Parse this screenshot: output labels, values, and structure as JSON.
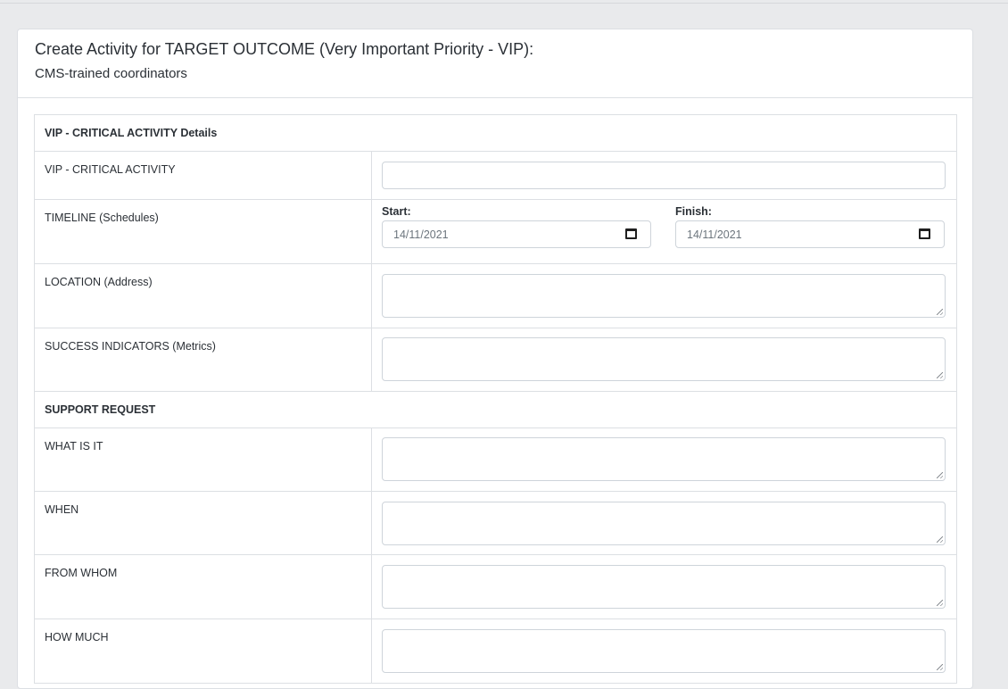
{
  "header": {
    "title": "Create Activity for TARGET OUTCOME (Very Important Priority - VIP):",
    "subtitle": "CMS-trained coordinators"
  },
  "form": {
    "section_details": "VIP - CRITICAL ACTIVITY Details",
    "row_activity_label": "VIP - CRITICAL ACTIVITY",
    "row_activity_value": "",
    "row_timeline_label": "TIMELINE (Schedules)",
    "start_label": "Start:",
    "start_value": "14/11/2021",
    "finish_label": "Finish:",
    "finish_value": "14/11/2021",
    "row_location_label": "LOCATION (Address)",
    "row_location_value": "",
    "row_success_label": "SUCCESS INDICATORS (Metrics)",
    "row_success_value": "",
    "section_support": "SUPPORT REQUEST",
    "row_what_label": "WHAT IS IT",
    "row_what_value": "",
    "row_when_label": "WHEN",
    "row_when_value": "",
    "row_whom_label": "FROM WHOM",
    "row_whom_value": "",
    "row_much_label": "HOW MUCH",
    "row_much_value": ""
  },
  "icons": {
    "date_picker": "calendar-icon",
    "textarea_resize": "resize-grip-icon"
  }
}
